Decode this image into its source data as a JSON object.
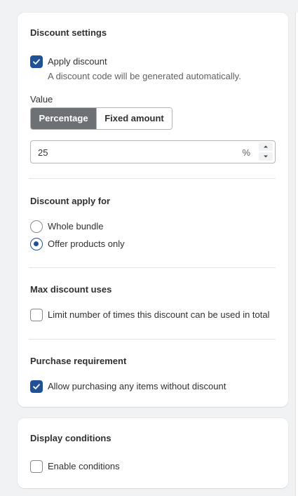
{
  "discount_settings": {
    "title": "Discount settings",
    "apply_discount": {
      "label": "Apply discount",
      "checked": true,
      "help": "A discount code will be generated automatically."
    },
    "value": {
      "label": "Value",
      "segments": [
        "Percentage",
        "Fixed amount"
      ],
      "selected": "Percentage",
      "amount": "25",
      "suffix": "%"
    },
    "apply_for": {
      "title": "Discount apply for",
      "options": [
        "Whole bundle",
        "Offer products only"
      ],
      "selected": "Offer products only"
    },
    "max_uses": {
      "title": "Max discount uses",
      "limit_label": "Limit number of times this discount can be used in total",
      "checked": false
    },
    "purchase_requirement": {
      "title": "Purchase requirement",
      "allow_label": "Allow purchasing any items without discount",
      "checked": true
    }
  },
  "display_conditions": {
    "title": "Display conditions",
    "enable_label": "Enable conditions",
    "checked": false
  },
  "colors": {
    "accent": "#1f5199",
    "segment_active": "#6d7175",
    "page_background": "#f1f2f4"
  }
}
